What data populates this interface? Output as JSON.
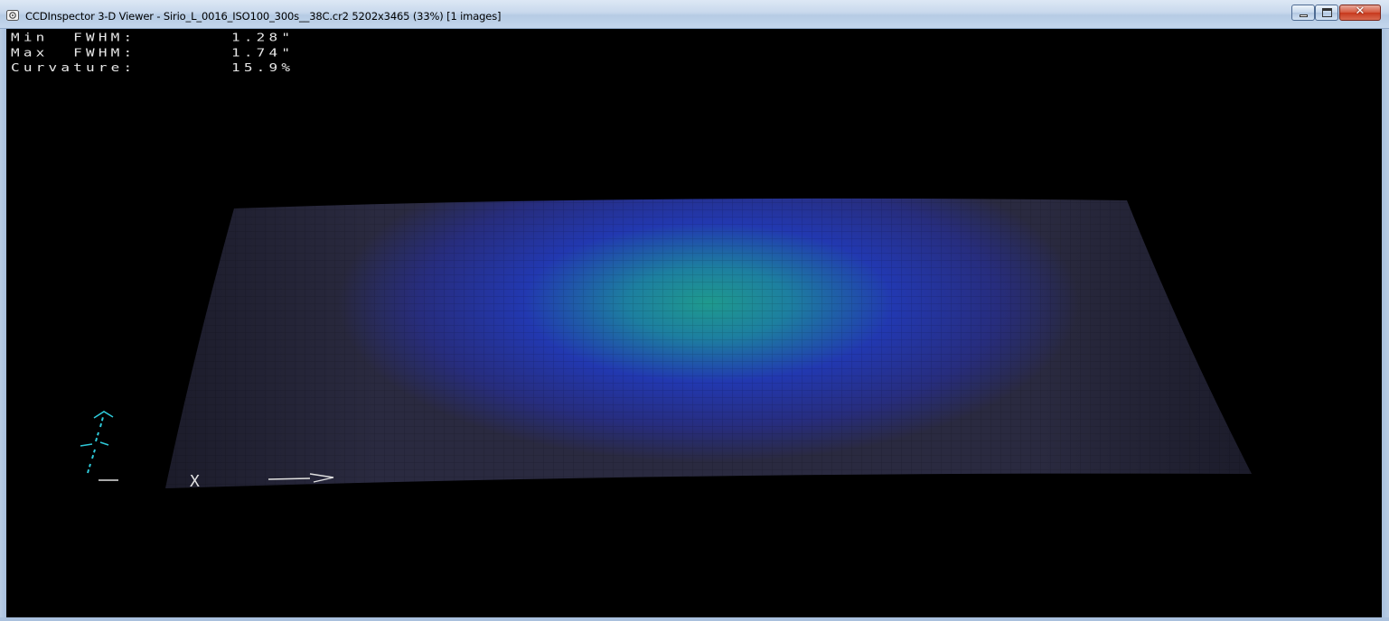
{
  "window": {
    "title": "CCDInspector 3-D Viewer - Sirio_L_0016_ISO100_300s__38C.cr2 5202x3465 (33%)  [1 images]",
    "icon": "ccdinspector-app-icon",
    "buttons": {
      "minimize": "minimize-icon",
      "maximize": "maximize-icon",
      "close": "close-icon"
    },
    "close_glyph": "✕"
  },
  "stats": [
    {
      "label": "Min  FWHM:",
      "value": "1.28\""
    },
    {
      "label": "Max  FWHM:",
      "value": "1.74\""
    },
    {
      "label": "Curvature:",
      "value": "15.9%"
    }
  ],
  "axes": {
    "x_label": "X",
    "x_arrow": "——>"
  },
  "colors": {
    "surface_low": "#2a2a3a",
    "surface_mid": "#2530a8",
    "surface_high": "#1e9e8e",
    "axis_y": "#2ec8d8",
    "text": "#e8e8e8"
  }
}
